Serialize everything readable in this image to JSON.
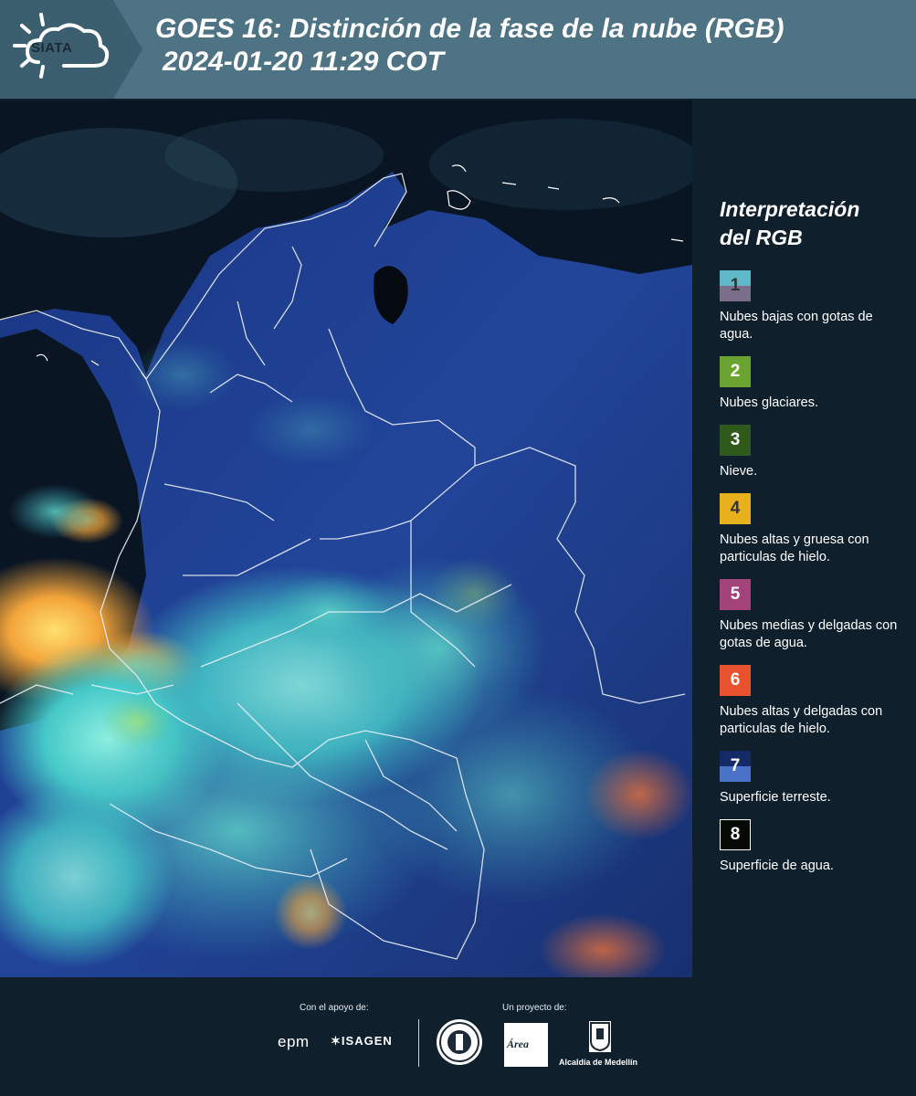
{
  "header": {
    "logo_text": "SIATA",
    "title_line1": "GOES 16: Distinción de la fase de la nube (RGB)",
    "title_line2": "2024-01-20 11:29 COT"
  },
  "legend": {
    "title_line1": "Interpretación",
    "title_line2": "del RGB",
    "items": [
      {
        "number": "1",
        "label": "Nubes bajas con gotas de agua.",
        "color_top": "#5fb8c8",
        "color_bottom": "#7a6e8a",
        "text_color": "#333333"
      },
      {
        "number": "2",
        "label": "Nubes glaciares.",
        "color": "#6aa32f",
        "text_color": "#ffffff"
      },
      {
        "number": "3",
        "label": "Nieve.",
        "color": "#2f5a1c",
        "text_color": "#ffffff"
      },
      {
        "number": "4",
        "label": "Nubes altas y gruesa con particulas de hielo.",
        "color": "#e7b01c",
        "text_color": "#333333"
      },
      {
        "number": "5",
        "label": "Nubes medias y delgadas con gotas de agua.",
        "color": "#a3437a",
        "text_color": "#ffffff"
      },
      {
        "number": "6",
        "label": "Nubes altas y delgadas con particulas de hielo.",
        "color": "#e8522c",
        "text_color": "#ffffff"
      },
      {
        "number": "7",
        "label": "Superficie terreste.",
        "color_top": "#142a66",
        "color_bottom": "#4a72c8",
        "text_color": "#ffffff"
      },
      {
        "number": "8",
        "label": "Superficie de agua.",
        "color": "#050a05",
        "border": "#ffffff",
        "text_color": "#ffffff"
      }
    ]
  },
  "footer": {
    "support_label": "Con el apoyo de:",
    "project_label": "Un proyecto de:",
    "sponsor_1": "epm",
    "sponsor_2": "ISAGEN",
    "partner_area": "Área",
    "partner_medellin": "Alcaldía de Medellín"
  },
  "colors": {
    "header_bg": "#4e7384",
    "page_bg": "#0f1f2c",
    "land": "#1f3a8a",
    "ocean": "#0a1524",
    "cloud_cyan": "#55d6d0",
    "cloud_orange": "#f0a030"
  }
}
